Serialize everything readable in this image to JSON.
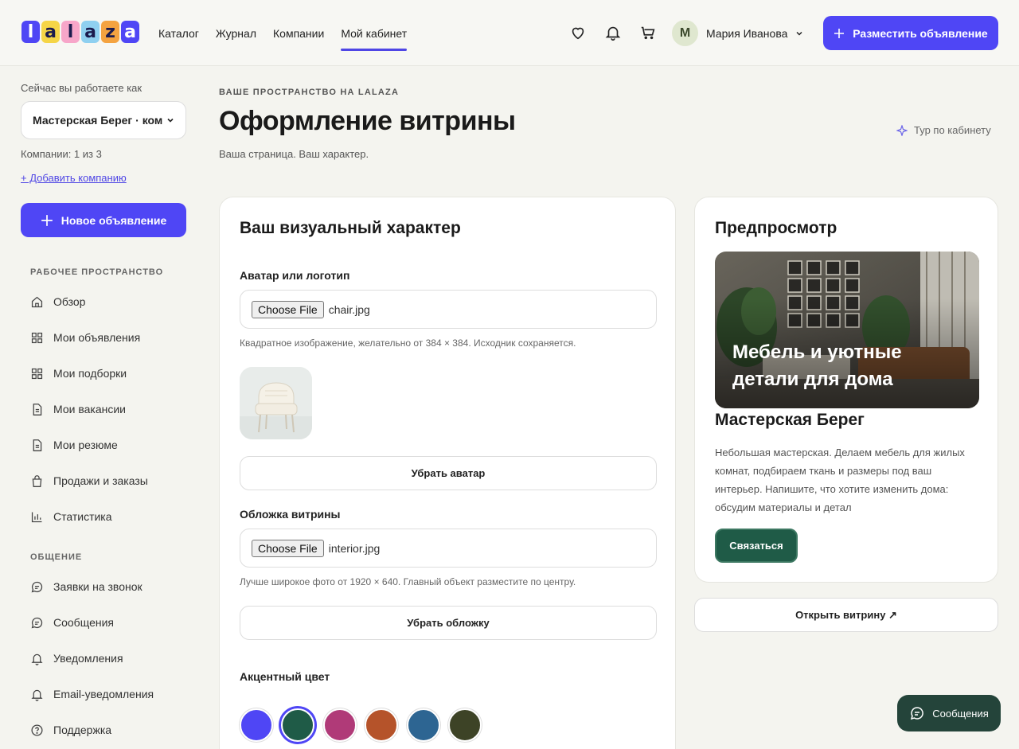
{
  "header": {
    "logo_letters": [
      "l",
      "a",
      "l",
      "a",
      "z",
      "a"
    ],
    "nav": [
      "Каталог",
      "Журнал",
      "Компании",
      "Мой кабинет"
    ],
    "active_nav": "Мой кабинет",
    "user_initial": "M",
    "user_name": "Мария Иванова",
    "cta_label": "Разместить объявление",
    "icons": [
      "heart-icon",
      "bell-icon",
      "cart-icon",
      "chevron-down-icon",
      "plus-icon"
    ]
  },
  "sidebar": {
    "working_as_label": "Сейчас вы работаете как",
    "company_selected": "Мастерская Берег · ком",
    "company_count": "Компании: 1 из 3",
    "add_company": "+ Добавить компанию",
    "new_ad_label": "Новое объявление",
    "workspace_title": "РАБОЧЕЕ ПРОСТРАНСТВО",
    "workspace_items": [
      {
        "label": "Обзор",
        "icon": "home-icon"
      },
      {
        "label": "Мои объявления",
        "icon": "grid-icon"
      },
      {
        "label": "Мои подборки",
        "icon": "grid-icon"
      },
      {
        "label": "Мои вакансии",
        "icon": "document-icon"
      },
      {
        "label": "Мои резюме",
        "icon": "document-icon"
      },
      {
        "label": "Продажи и заказы",
        "icon": "bag-icon"
      },
      {
        "label": "Статистика",
        "icon": "chart-icon"
      }
    ],
    "comm_title": "ОБЩЕНИЕ",
    "comm_items": [
      {
        "label": "Заявки на звонок",
        "icon": "chat-icon"
      },
      {
        "label": "Сообщения",
        "icon": "chat-icon"
      },
      {
        "label": "Уведомления",
        "icon": "bell-icon"
      },
      {
        "label": "Email-уведомления",
        "icon": "bell-icon"
      },
      {
        "label": "Поддержка",
        "icon": "help-icon"
      }
    ]
  },
  "page": {
    "eyebrow": "ВАШЕ ПРОСТРАНСТВО НА LALAZA",
    "title": "Оформление витрины",
    "subtitle": "Ваша страница. Ваш характер.",
    "tour": "Тур по кабинету"
  },
  "visual_card": {
    "title": "Ваш визуальный характер",
    "avatar_label": "Аватар или логотип",
    "choose_file": "Choose File",
    "avatar_file": "chair.jpg",
    "avatar_hint": "Квадратное изображение, желательно от 384 × 384. Исходник сохраняется.",
    "remove_avatar": "Убрать аватар",
    "cover_label": "Обложка витрины",
    "cover_file": "interior.jpg",
    "cover_hint": "Лучше широкое фото от 1920 × 640. Главный объект разместите по центру.",
    "remove_cover": "Убрать обложку",
    "accent_label": "Акцентный цвет",
    "accent_colors": [
      "#4f46f5",
      "#1f5b47",
      "#b03a78",
      "#b5532a",
      "#2d6592",
      "#3d4326"
    ],
    "selected_color": "#1f5b47"
  },
  "preview": {
    "title": "Предпросмотр",
    "cover_text": "Мебель и уютные детали для дома",
    "name": "Мастерская Берег",
    "description": "Небольшая мастерская. Делаем мебель для жилых комнат, подбираем ткань и размеры под ваш интерьер. Напишите, что хотите изменить дома: обсудим материалы и детал",
    "contact": "Связаться",
    "open_showcase": "Открыть витрину ↗"
  },
  "chat": {
    "label": "Сообщения"
  }
}
